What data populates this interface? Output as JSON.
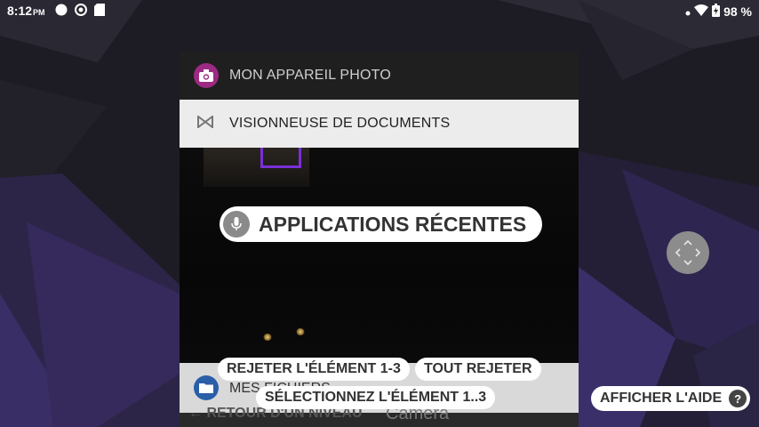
{
  "status_bar": {
    "time": "8:12",
    "ampm": "PM",
    "battery_percent": "98 %"
  },
  "recents": {
    "camera_card": {
      "title": "MON APPAREIL PHOTO",
      "icon": "camera-icon",
      "accent": "#9c2a83"
    },
    "docs_card": {
      "title": "VISIONNEUSE DE DOCUMENTS",
      "icon": "doc-viewer-icon"
    },
    "files_card": {
      "title": "MES FICHIERS",
      "icon": "folder-icon",
      "accent": "#2b5ea8"
    },
    "back_label": "RETOUR D'UN NIVEAU",
    "camera_text": "Camera"
  },
  "voice_overlay": {
    "main_label": "APPLICATIONS RÉCENTES",
    "dismiss_item": "REJETER L'ÉLÉMENT 1-3",
    "dismiss_all": "TOUT REJETER",
    "select_item": "SÉLECTIONNEZ L'ÉLÉMENT 1..3",
    "help": "AFFICHER L'AIDE",
    "help_glyph": "?"
  }
}
